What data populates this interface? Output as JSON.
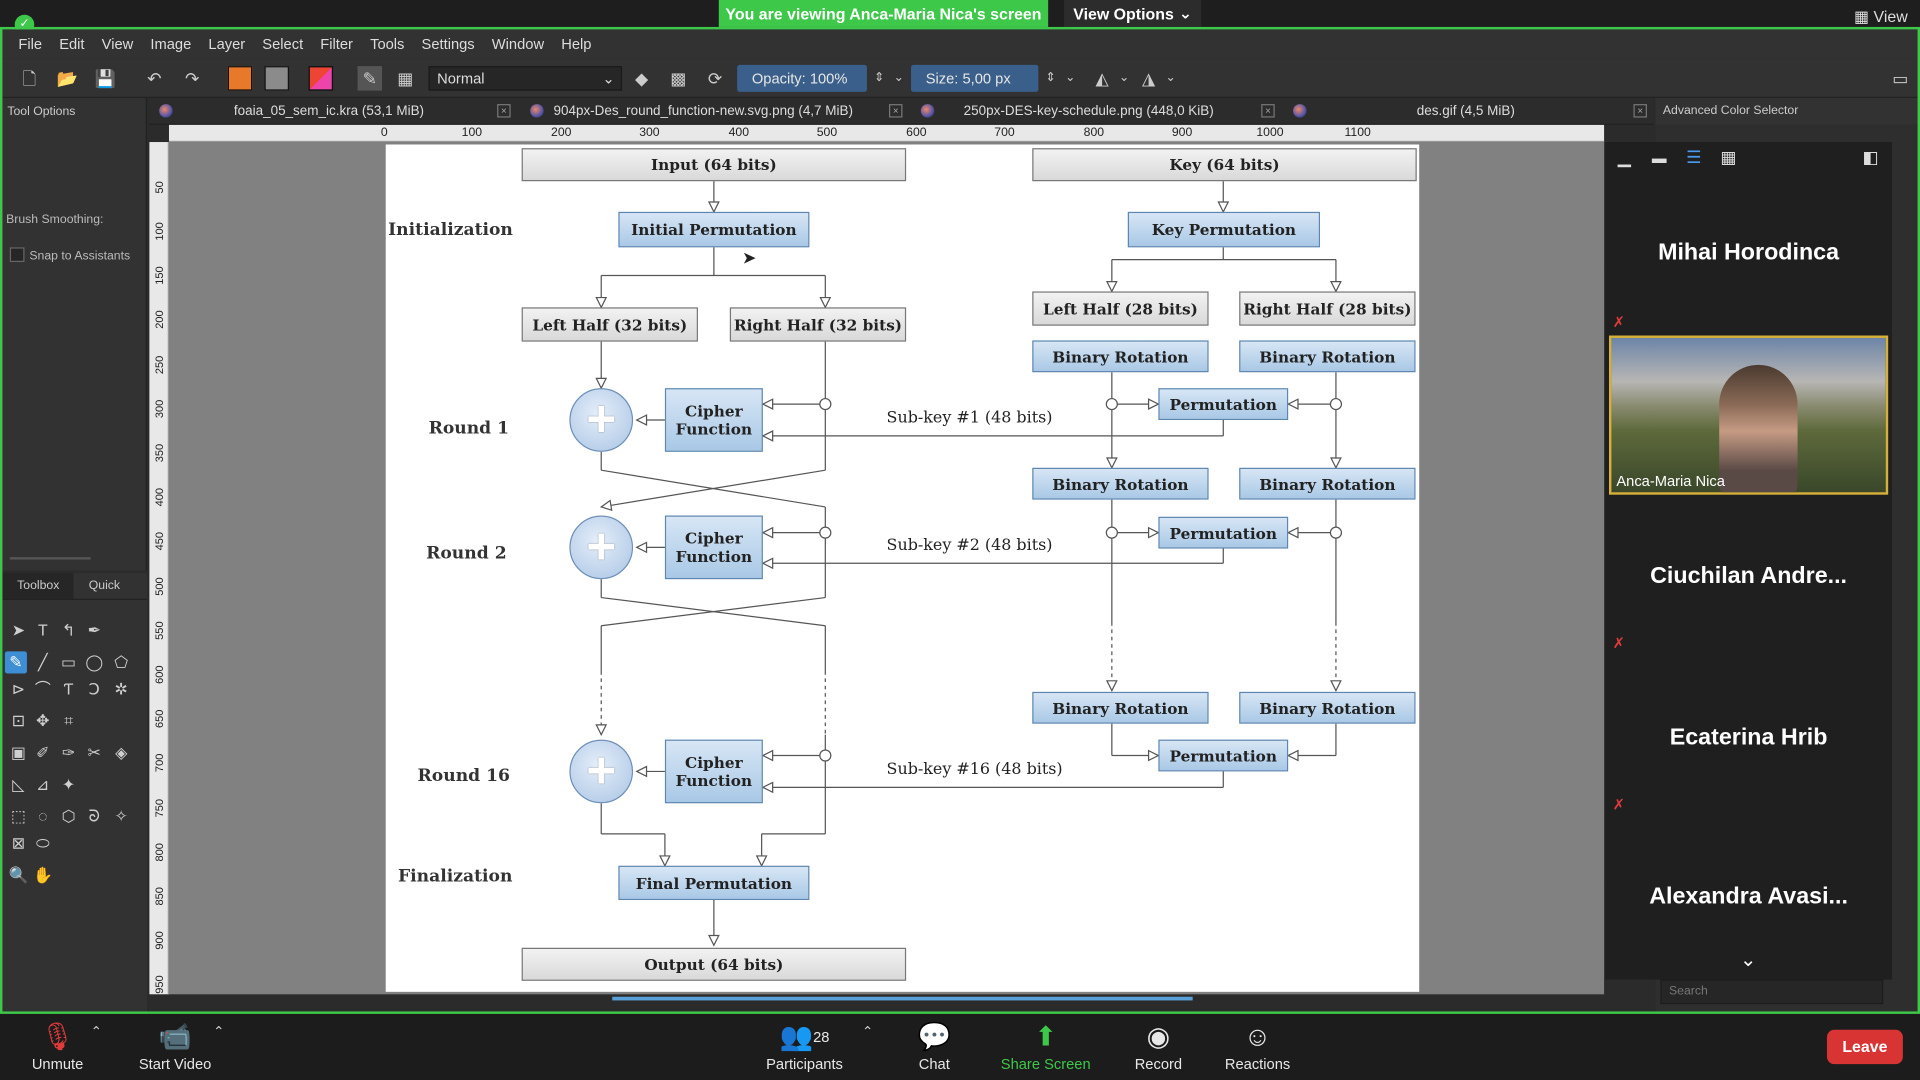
{
  "zoom": {
    "share_banner": "You are viewing Anca-Maria Nica's screen",
    "view_options": "View Options",
    "view_top": "View",
    "bottom": {
      "unmute": "Unmute",
      "start_video": "Start Video",
      "participants": "Participants",
      "participants_count": "28",
      "chat": "Chat",
      "share_screen": "Share Screen",
      "record": "Record",
      "reactions": "Reactions",
      "leave": "Leave"
    },
    "participants_list": [
      "Mihai Horodinca",
      "Anca-Maria Nica",
      "Ciuchilan  Andre...",
      "Ecaterina Hrib",
      "Alexandra  Avasi..."
    ]
  },
  "krita": {
    "menu": [
      "File",
      "Edit",
      "View",
      "Image",
      "Layer",
      "Select",
      "Filter",
      "Tools",
      "Settings",
      "Window",
      "Help"
    ],
    "blend_mode": "Normal",
    "opacity": "Opacity:  100%",
    "size": "Size:  5,00 px",
    "tool_options_title": "Tool Options",
    "brush_smoothing": "Brush Smoothing:",
    "snap_to_assistants": "Snap to Assistants",
    "toolbox_tab": "Toolbox",
    "quick_tab": "Quick",
    "advanced_color_selector": "Advanced Color Selector",
    "search_placeholder": "Search",
    "tabs": [
      "foaia_05_sem_ic.kra (53,1 MiB)",
      "904px-Des_round_function-new.svg.png (4,7 MiB)",
      "250px-DES-key-schedule.png (448,0 KiB)",
      "des.gif (4,5 MiB)"
    ],
    "ruler_top": [
      "0",
      "100",
      "200",
      "300",
      "400",
      "500",
      "600",
      "700",
      "800",
      "900",
      "1000",
      "1100"
    ],
    "ruler_left": [
      "50",
      "100",
      "150",
      "200",
      "250",
      "300",
      "350",
      "400",
      "450",
      "500",
      "550",
      "600",
      "650",
      "700",
      "750",
      "800",
      "850",
      "900",
      "950"
    ]
  },
  "diagram": {
    "input": "Input (64 bits)",
    "key": "Key (64 bits)",
    "initial_permutation": "Initial Permutation",
    "key_permutation": "Key Permutation",
    "left_half_32": "Left Half (32 bits)",
    "right_half_32": "Right Half (32 bits)",
    "left_half_28": "Left Half (28 bits)",
    "right_half_28": "Right Half (28 bits)",
    "binary_rotation": "Binary Rotation",
    "permutation": "Permutation",
    "cipher_function": "Cipher Function",
    "sub_key_1": "Sub-key #1 (48 bits)",
    "sub_key_2": "Sub-key #2 (48 bits)",
    "sub_key_16": "Sub-key #16 (48 bits)",
    "initialization": "Initialization",
    "round_1": "Round 1",
    "round_2": "Round 2",
    "round_16": "Round 16",
    "finalization": "Finalization",
    "final_permutation": "Final Permutation",
    "output": "Output (64 bits)"
  }
}
